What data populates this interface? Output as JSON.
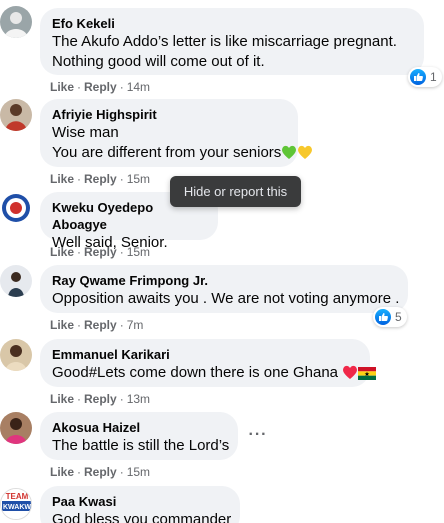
{
  "tooltip": "Hide or report this",
  "comments": [
    {
      "author": "Efo Kekeli",
      "lines": [
        "The Akufo Addo’s letter is like miscarriage pregnant.",
        "Nothing good will come out of it."
      ],
      "like": "Like",
      "reply": "Reply",
      "time": "14m",
      "reactions": "1"
    },
    {
      "author": "Afriyie Highspirit",
      "lines": [
        "Wise man",
        "You are different from your seniors"
      ],
      "like": "Like",
      "reply": "Reply",
      "time": "15m",
      "emojis": [
        "green-heart",
        "yellow-heart"
      ]
    },
    {
      "author": "Kweku Oyedepo Aboagye",
      "lines": [
        "Well said, Senior."
      ],
      "like": "Like",
      "reply": "Reply",
      "time": "15m"
    },
    {
      "author": "Ray Qwame Frimpong Jr.",
      "lines": [
        "Opposition awaits you . We are not voting anymore ."
      ],
      "like": "Like",
      "reply": "Reply",
      "time": "7m",
      "reactions": "5"
    },
    {
      "author": "Emmanuel Karikari",
      "lines": [
        "Good#Lets come down there is one Ghana"
      ],
      "like": "Like",
      "reply": "Reply",
      "time": "13m",
      "emojis": [
        "red-heart",
        "ghana-flag"
      ]
    },
    {
      "author": "Akosua Haizel",
      "lines": [
        "The battle is still the Lord’s"
      ],
      "like": "Like",
      "reply": "Reply",
      "time": "15m"
    },
    {
      "author": "Paa Kwasi",
      "lines": [
        "God bless you commander"
      ],
      "avatar_text": [
        "TEAM",
        "KWAKW"
      ]
    }
  ],
  "colors": {
    "bubble": "#f0f2f5",
    "meta": "#65676b",
    "like_blue": "#1877f2"
  }
}
